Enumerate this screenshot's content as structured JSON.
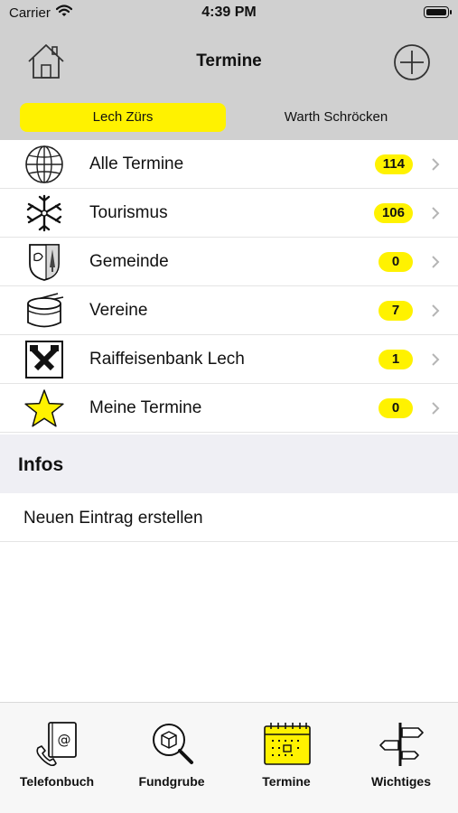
{
  "status_bar": {
    "carrier": "Carrier",
    "time": "4:39 PM"
  },
  "nav": {
    "title": "Termine",
    "home_icon": "house-icon",
    "add_icon": "plus-circle-icon"
  },
  "segments": [
    {
      "label": "Lech Zürs",
      "selected": true
    },
    {
      "label": "Warth Schröcken",
      "selected": false
    }
  ],
  "rows": [
    {
      "label": "Alle Termine",
      "count": "114",
      "icon": "globe-icon"
    },
    {
      "label": "Tourismus",
      "count": "106",
      "icon": "snowflake-icon"
    },
    {
      "label": "Gemeinde",
      "count": "0",
      "icon": "coat-of-arms-icon"
    },
    {
      "label": "Vereine",
      "count": "7",
      "icon": "drum-icon"
    },
    {
      "label": "Raiffeisenbank Lech",
      "count": "1",
      "icon": "raiffeisen-logo-icon"
    },
    {
      "label": "Meine Termine",
      "count": "0",
      "icon": "star-icon"
    }
  ],
  "infos": {
    "title": "Infos",
    "items": [
      {
        "label": "Neuen Eintrag erstellen"
      }
    ]
  },
  "tabs": [
    {
      "label": "Telefonbuch",
      "icon": "phonebook-icon",
      "selected": false
    },
    {
      "label": "Fundgrube",
      "icon": "magnifier-box-icon",
      "selected": false
    },
    {
      "label": "Termine",
      "icon": "calendar-icon",
      "selected": true
    },
    {
      "label": "Wichtiges",
      "icon": "signpost-icon",
      "selected": false
    }
  ],
  "colors": {
    "accent": "#fff200",
    "bar_gray": "#d0d0d0",
    "section_gray": "#efeff4"
  }
}
